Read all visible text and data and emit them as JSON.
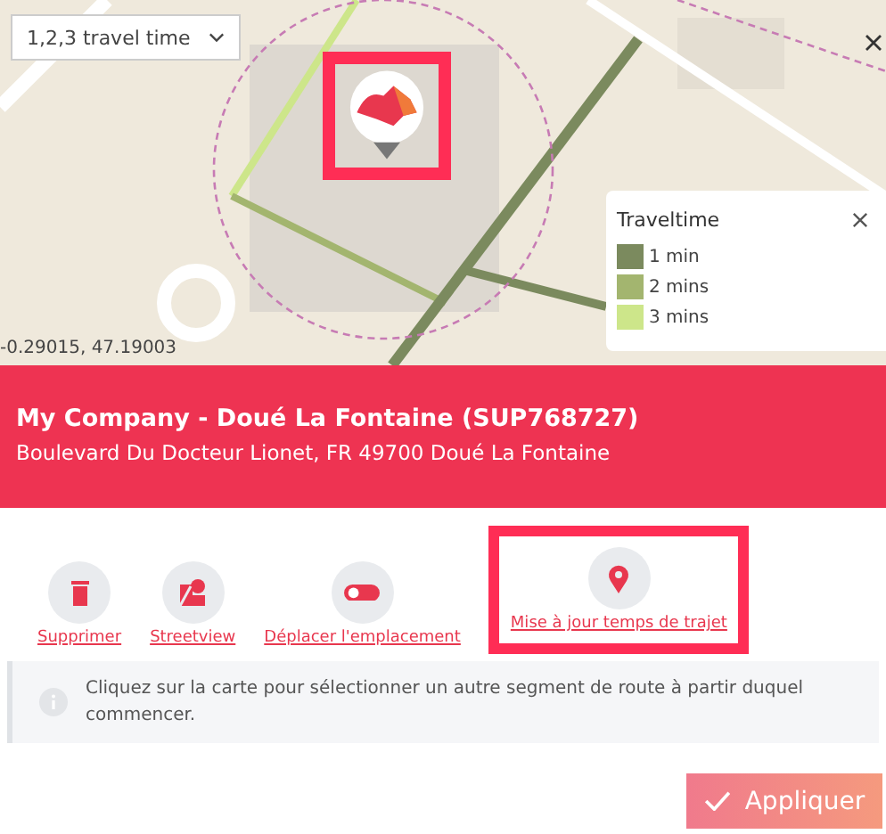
{
  "map": {
    "kind": "picture",
    "dropdown": {
      "value": "1,2,3 travel time"
    },
    "coordinates": "-0.29015, 47.19003",
    "marker_highlighted": true,
    "legend": {
      "title": "Traveltime",
      "items": [
        {
          "label": "1 min",
          "color": "#7b8a5e"
        },
        {
          "label": "2 mins",
          "color": "#a3b56f"
        },
        {
          "label": "3 mins",
          "color": "#cde68a"
        }
      ]
    }
  },
  "header": {
    "title": "My Company - Doué La Fontaine (SUP768727)",
    "address": "Boulevard Du Docteur Lionet, FR 49700 Doué La Fontaine"
  },
  "actions": [
    {
      "kind": "trash",
      "label": "Supprimer",
      "highlighted": false
    },
    {
      "kind": "streetview",
      "label": "Streetview",
      "highlighted": false
    },
    {
      "kind": "toggle",
      "label": "Déplacer l'emplacement",
      "highlighted": false
    },
    {
      "kind": "pin",
      "label": "Mise à jour temps de trajet",
      "highlighted": true
    }
  ],
  "info": "Cliquez sur la carte pour sélectionner un autre segment de route à partir duquel commencer.",
  "apply_button": "Appliquer"
}
